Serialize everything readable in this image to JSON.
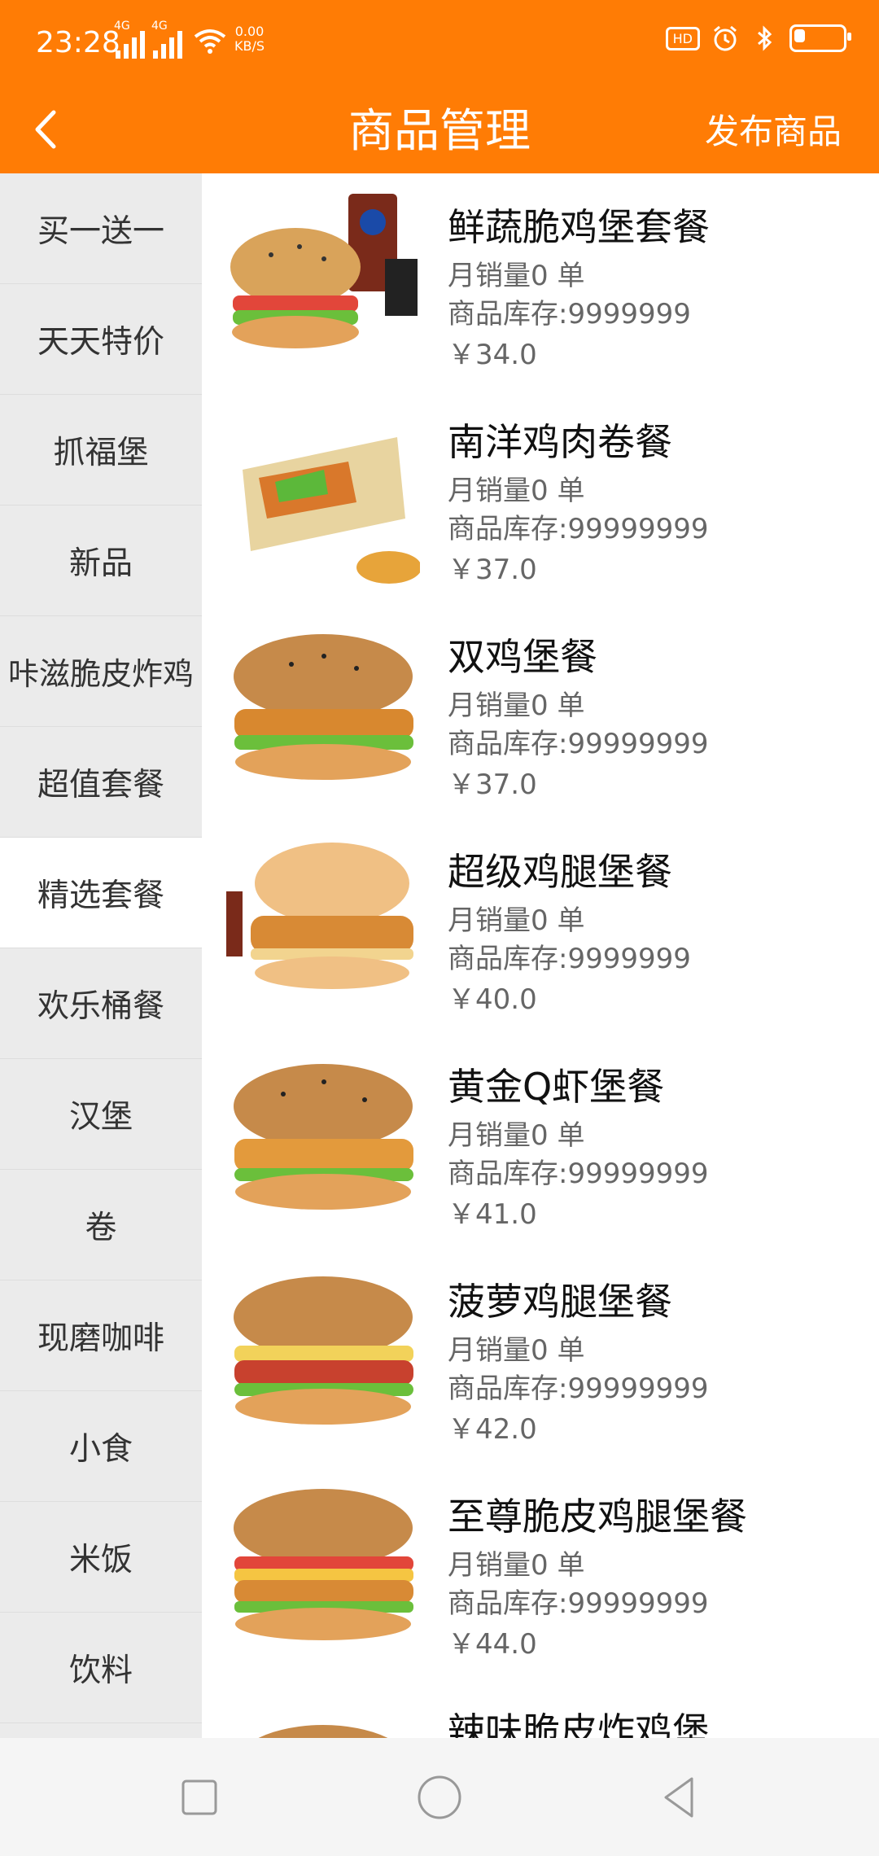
{
  "status": {
    "time": "23:28",
    "net1": "4G",
    "net2": "4G",
    "speed_value": "0.00",
    "speed_unit": "KB/S",
    "hd_label": "HD",
    "battery_level": 0.25
  },
  "header": {
    "title": "商品管理",
    "publish_label": "发布商品"
  },
  "sidebar": {
    "items": [
      {
        "label": "买一送一"
      },
      {
        "label": "天天特价"
      },
      {
        "label": "抓福堡"
      },
      {
        "label": "新品"
      },
      {
        "label": "咔滋脆皮炸鸡"
      },
      {
        "label": "超值套餐"
      },
      {
        "label": "精选套餐",
        "active": true
      },
      {
        "label": "欢乐桶餐"
      },
      {
        "label": "汉堡"
      },
      {
        "label": "卷"
      },
      {
        "label": "现磨咖啡"
      },
      {
        "label": "小食"
      },
      {
        "label": "米饭"
      },
      {
        "label": "饮料"
      }
    ]
  },
  "products": [
    {
      "name": "鲜蔬脆鸡堡套餐",
      "sales": "月销量0 单",
      "stock": "商品库存:9999999",
      "price": "￥34.0"
    },
    {
      "name": "南洋鸡肉卷餐",
      "sales": "月销量0 单",
      "stock": "商品库存:99999999",
      "price": "￥37.0"
    },
    {
      "name": "双鸡堡餐",
      "sales": "月销量0 单",
      "stock": "商品库存:99999999",
      "price": "￥37.0"
    },
    {
      "name": "超级鸡腿堡餐",
      "sales": "月销量0 单",
      "stock": "商品库存:9999999",
      "price": "￥40.0"
    },
    {
      "name": "黄金Q虾堡餐",
      "sales": "月销量0 单",
      "stock": "商品库存:99999999",
      "price": "￥41.0"
    },
    {
      "name": "菠萝鸡腿堡餐",
      "sales": "月销量0 单",
      "stock": "商品库存:99999999",
      "price": "￥42.0"
    },
    {
      "name": "至尊脆皮鸡腿堡餐",
      "sales": "月销量0 单",
      "stock": "商品库存:99999999",
      "price": "￥44.0"
    },
    {
      "name": "辣味脆皮炸鸡堡"
    }
  ],
  "colors": {
    "accent": "#FF7C05",
    "sidebar_bg": "#EBEBEB"
  },
  "icons": {
    "back": "chevron-left-icon",
    "nav_recent": "square-icon",
    "nav_home": "circle-icon",
    "nav_back": "triangle-back-icon"
  }
}
